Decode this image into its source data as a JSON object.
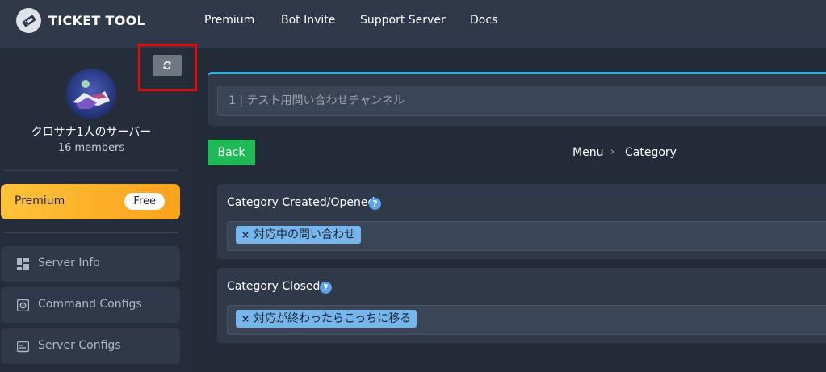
{
  "brand": {
    "name": "TICKET TOOL"
  },
  "nav": [
    {
      "label": "Premium"
    },
    {
      "label": "Bot Invite"
    },
    {
      "label": "Support Server"
    },
    {
      "label": "Docs"
    }
  ],
  "server": {
    "name": "クロサナ1人のサーバー",
    "members": "16 members"
  },
  "premium": {
    "label": "Premium",
    "badge": "Free"
  },
  "sidebar_menu": [
    {
      "label": "Server Info",
      "icon": "dashboard-icon"
    },
    {
      "label": "Command Configs",
      "icon": "settings-square-icon"
    },
    {
      "label": "Server Configs",
      "icon": "server-config-icon"
    }
  ],
  "refresh": {
    "icon": "refresh-icon"
  },
  "channel": {
    "value": "1 | テスト用問い合わせチャンネル"
  },
  "actions": {
    "back": "Back"
  },
  "breadcrumb": {
    "root": "Menu",
    "separator": "›",
    "current": "Category"
  },
  "panels": [
    {
      "title": "Category Created/Opened",
      "help": "?",
      "tag_remove": "×",
      "tag": "対応中の問い合わせ"
    },
    {
      "title": "Category Closed",
      "help": "?",
      "tag_remove": "×",
      "tag": "対応が終わったらこっちに移る"
    }
  ],
  "colors": {
    "accent_green": "#1fb955",
    "premium_gold": "#f9a21c",
    "tag_blue": "#76b6ed",
    "highlight_red": "#e30b0b",
    "card_border": "#2cb6e4"
  }
}
